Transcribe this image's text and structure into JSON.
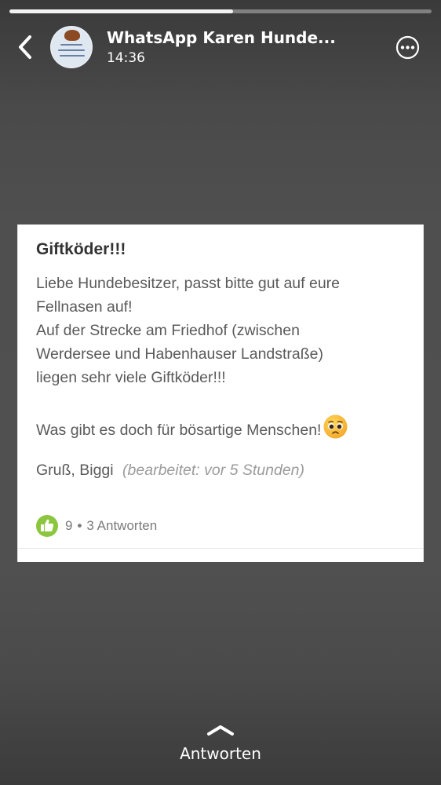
{
  "progress": {
    "fraction": 0.53
  },
  "header": {
    "title": "WhatsApp Karen Hunde...",
    "time": "14:36"
  },
  "post": {
    "title": "Giftköder!!!",
    "lines": [
      "Liebe Hundebesitzer, passt bitte gut auf eure",
      "Fellnasen auf!",
      "Auf der Strecke am Friedhof (zwischen",
      "Werdersee und Habenhauser Landstraße)",
      "liegen sehr viele Giftköder!!!",
      "Was gibt es doch für bösartige Menschen!"
    ],
    "emoji": "pleading-face-icon",
    "signature": "Gruß, Biggi",
    "edited": "(bearbeitet: vor 5 Stunden)",
    "likes": "9",
    "separator": "•",
    "replies": "3 Antworten"
  },
  "reply": {
    "label": "Antworten"
  },
  "colors": {
    "like_green": "#8cc63f",
    "text_gray": "#5a5a5a",
    "title_dark": "#333333"
  }
}
